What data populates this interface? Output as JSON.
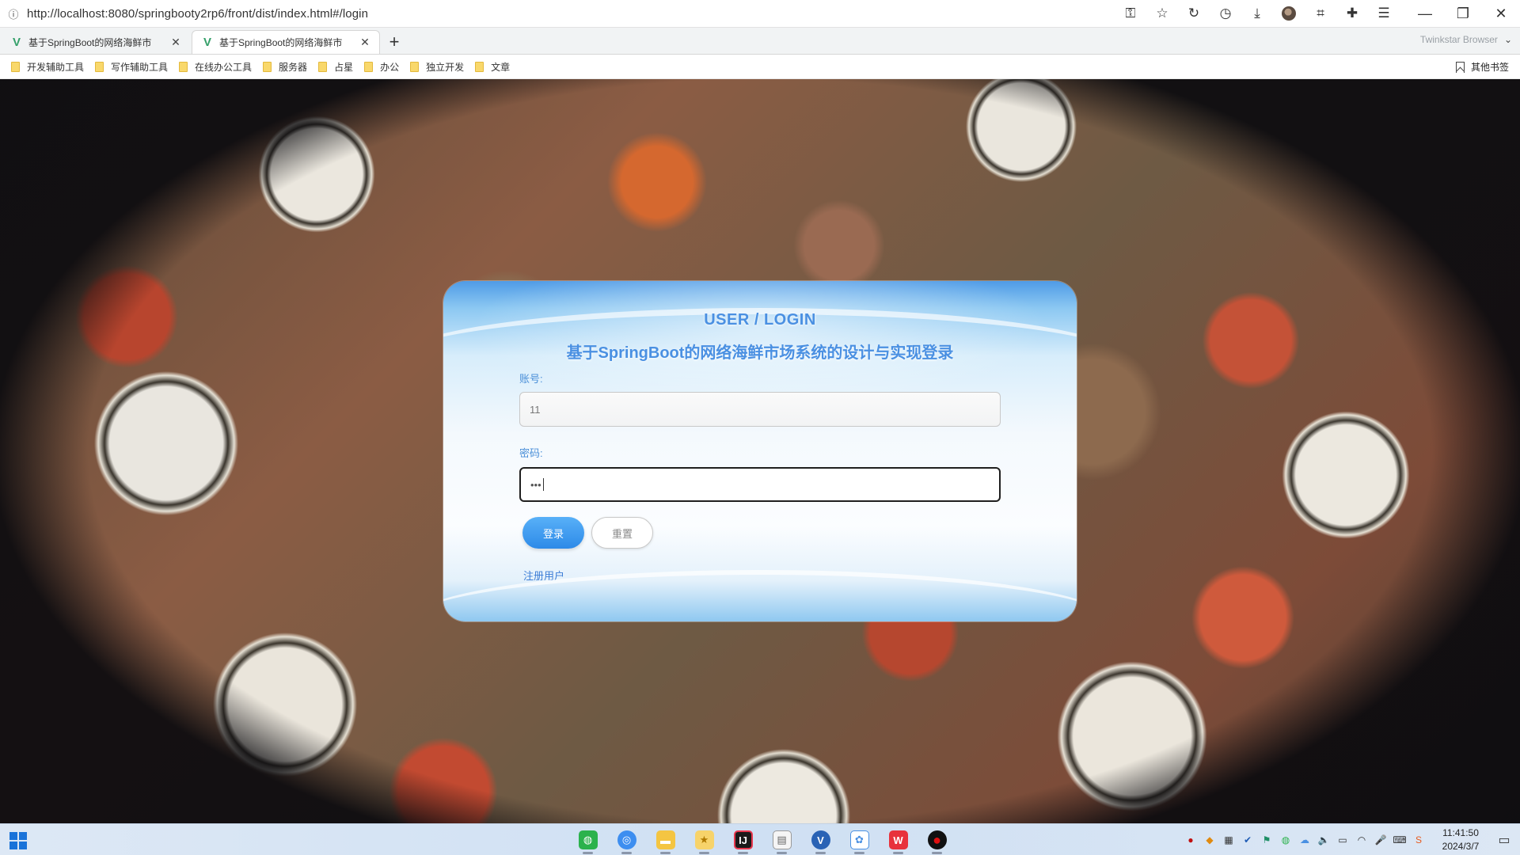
{
  "browser": {
    "url": "http://localhost:8080/springbooty2rp6/front/dist/index.html#/login",
    "brand": "Twinkstar Browser",
    "tabs": [
      {
        "title": "基于SpringBoot的网络海鲜市",
        "active": false
      },
      {
        "title": "基于SpringBoot的网络海鲜市",
        "active": true
      }
    ],
    "bookmarks": [
      "开发辅助工具",
      "写作辅助工具",
      "在线办公工具",
      "服务器",
      "占星",
      "办公",
      "独立开发",
      "文章"
    ],
    "other_bookmarks": "其他书签",
    "toolbar_icons": [
      "key-icon",
      "star-icon",
      "reload-icon",
      "history-icon",
      "download-icon",
      "avatar",
      "crop-icon",
      "extension-icon",
      "menu-icon"
    ]
  },
  "login": {
    "title": "USER / LOGIN",
    "subtitle": "基于SpringBoot的网络海鲜市场系统的设计与实现登录",
    "account_label": "账号:",
    "account_value": "11",
    "password_label": "密码:",
    "password_value": "•••",
    "login_button": "登录",
    "reset_button": "重置",
    "register_link": "注册用户",
    "accent_color": "#4a90e2"
  },
  "taskbar": {
    "apps": [
      "wechat-icon",
      "browser-icon",
      "file-explorer-icon",
      "star-app-icon",
      "intellij-icon",
      "notepad-icon",
      "v-app-icon",
      "network-app-icon",
      "wps-icon",
      "record-icon"
    ],
    "time": "11:41:50",
    "date": "2024/3/7"
  }
}
